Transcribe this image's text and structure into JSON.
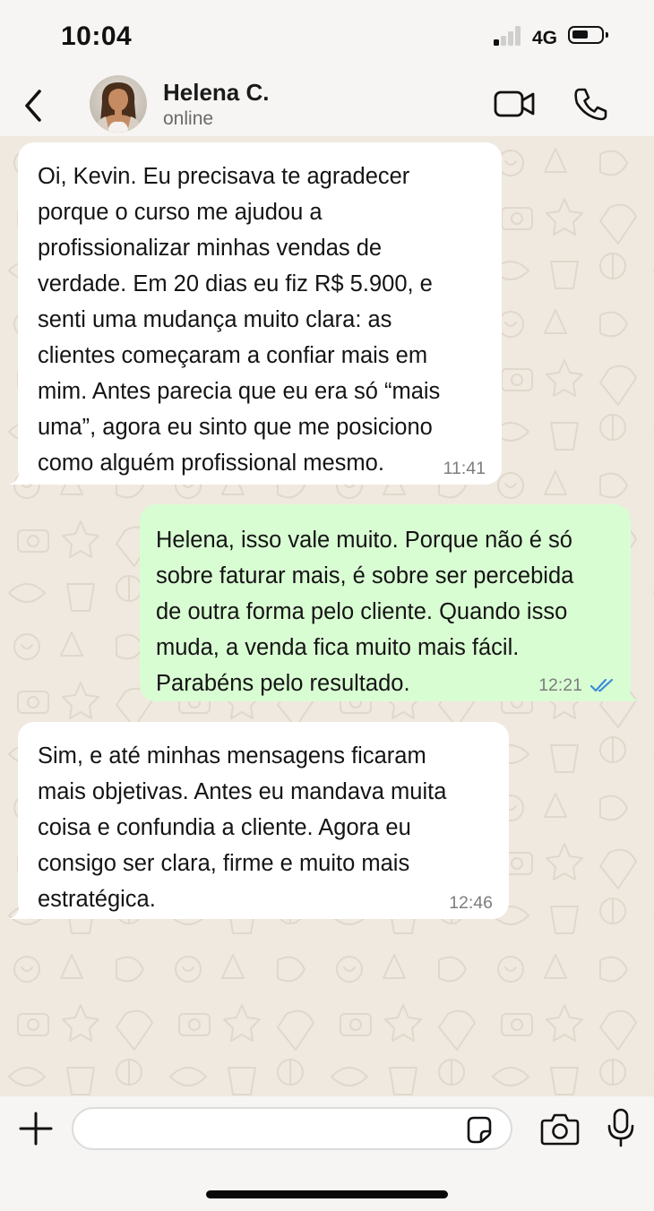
{
  "status_bar": {
    "time": "10:04",
    "network": "4G",
    "signal_bars_active": 1,
    "signal_bars_total": 4,
    "icons": [
      "signal-icon",
      "battery-icon"
    ]
  },
  "header": {
    "contact_name": "Helena C.",
    "contact_status": "online",
    "icons": [
      "back-chevron-icon",
      "avatar",
      "video-camera-icon",
      "phone-icon"
    ]
  },
  "messages": [
    {
      "direction": "incoming",
      "text": "Oi, Kevin. Eu precisava te agradecer\nporque o curso me ajudou a\nprofissionalizar minhas vendas de\nverdade. Em 20 dias eu fiz R$ 5.900, e\nsenti uma mudança muito clara: as\nclientes começaram a confiar mais em\nmim. Antes parecia que eu era só “mais\numa”, agora eu sinto que me posiciono\ncomo alguém profissional mesmo.",
      "time": "11:41"
    },
    {
      "direction": "outgoing",
      "text": "Helena, isso vale muito. Porque não é só\nsobre faturar mais, é sobre ser percebida\nde outra forma pelo cliente. Quando isso\nmuda, a venda fica muito mais fácil.\nParabéns pelo resultado.",
      "time": "12:21",
      "read_receipt": "double-check-icon"
    },
    {
      "direction": "incoming",
      "text": "Sim, e até minhas mensagens ficaram\nmais objetivas. Antes eu mandava muita\ncoisa e confundia a cliente. Agora eu\nconsigo ser clara, firme e muito mais\nestratégica.",
      "time": "12:46"
    }
  ],
  "composer": {
    "input_value": "",
    "input_placeholder": "",
    "icons": [
      "plus-icon",
      "sticker-icon",
      "camera-icon",
      "microphone-icon"
    ]
  },
  "colors": {
    "incoming_bubble": "#ffffff",
    "outgoing_bubble": "#d9fdd3",
    "chat_background": "#efe9e0",
    "bar_background": "#f6f5f3",
    "read_receipt": "#3b8bd9",
    "timestamp": "#7d7d7d"
  }
}
